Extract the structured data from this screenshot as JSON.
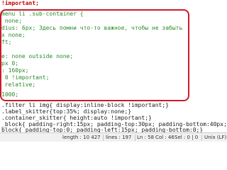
{
  "editor": {
    "lines": [
      {
        "text": "!important;",
        "color": "red"
      },
      {
        "text": "menu li .sub-container {",
        "color": "green"
      },
      {
        "text": " none;",
        "color": "green"
      },
      {
        "text": "dius: 6px; Здесь помни что-то важное, чтобы не забыть",
        "color": "green"
      },
      {
        "text": "x none;",
        "color": "green"
      },
      {
        "text": "ft;",
        "color": "green"
      },
      {
        "text": "",
        "color": "green"
      },
      {
        "text": "e: none outside none;",
        "color": "green"
      },
      {
        "text": "px 0;",
        "color": "green"
      },
      {
        "text": ": 160px;",
        "color": "green"
      },
      {
        "text": " 0 !important;",
        "color": "green"
      },
      {
        "text": " relative;",
        "color": "green"
      },
      {
        "text": "",
        "color": "green"
      },
      {
        "text": "1000;",
        "color": "green"
      },
      {
        "text": "",
        "color": "green"
      },
      {
        "text": ".filter li img{ display:inline-block !important;}",
        "color": "black"
      },
      {
        "text": ".label_skitter{top:35%; display:none;}",
        "color": "black"
      },
      {
        "text": ".container_skitter{ height:auto !important;}",
        "color": "black"
      },
      {
        "text": "_block{ padding-right:15px; padding-top:30px; padding-bottom:40px;}",
        "color": "black"
      },
      {
        "text": "block{ padding-top:0; padding-left:15px; padding-bottom:0;}",
        "color": "black"
      }
    ]
  },
  "statusbar": {
    "length": "length : 10 427",
    "lines": "lines : 197",
    "ln": "Ln : 58",
    "col": "Col : 46",
    "sel": "Sel : 0 | 0",
    "eol": "Unix (LF)"
  },
  "colors": {
    "highlight_border": "#cc1b2a",
    "red_text": "#c40000",
    "green_text": "#2a8a2a"
  }
}
